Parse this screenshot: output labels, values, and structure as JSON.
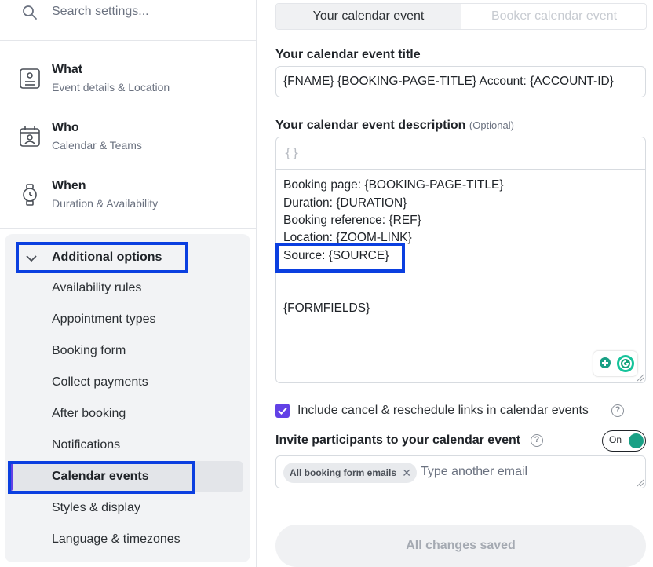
{
  "search": {
    "placeholder": "Search settings..."
  },
  "nav": [
    {
      "title": "What",
      "subtitle": "Event details & Location",
      "icon": "profile-card-icon"
    },
    {
      "title": "Who",
      "subtitle": "Calendar & Teams",
      "icon": "calendar-person-icon"
    },
    {
      "title": "When",
      "subtitle": "Duration & Availability",
      "icon": "watch-icon"
    }
  ],
  "additional": {
    "label": "Additional options",
    "items": [
      "Availability rules",
      "Appointment types",
      "Booking form",
      "Collect payments",
      "After booking",
      "Notifications",
      "Calendar events",
      "Styles & display",
      "Language & timezones"
    ],
    "active": "Calendar events"
  },
  "tabs": {
    "active": "Your calendar event",
    "inactive": "Booker calendar event"
  },
  "event_title": {
    "label": "Your calendar event title",
    "value": "{FNAME} {BOOKING-PAGE-TITLE} Account: {ACCOUNT-ID}"
  },
  "event_description": {
    "label": "Your calendar event description",
    "optional": "(Optional)",
    "toolbar_icon": "{}",
    "lines": [
      "Booking page: {BOOKING-PAGE-TITLE}",
      "Duration: {DURATION}",
      "Booking reference: {REF}",
      "Location: {ZOOM-LINK}",
      "Source: {SOURCE}",
      "{FORMFIELDS}"
    ]
  },
  "include_links": {
    "label": "Include cancel & reschedule links in calendar events",
    "checked": true
  },
  "invite": {
    "label": "Invite participants to your calendar event",
    "toggle": "On",
    "chip": "All booking form emails",
    "placeholder": "Type another email"
  },
  "save_button": "All changes saved",
  "colors": {
    "accent": "#6241e6",
    "highlight": "#0b3fe0",
    "toggle_on": "#19a085"
  }
}
